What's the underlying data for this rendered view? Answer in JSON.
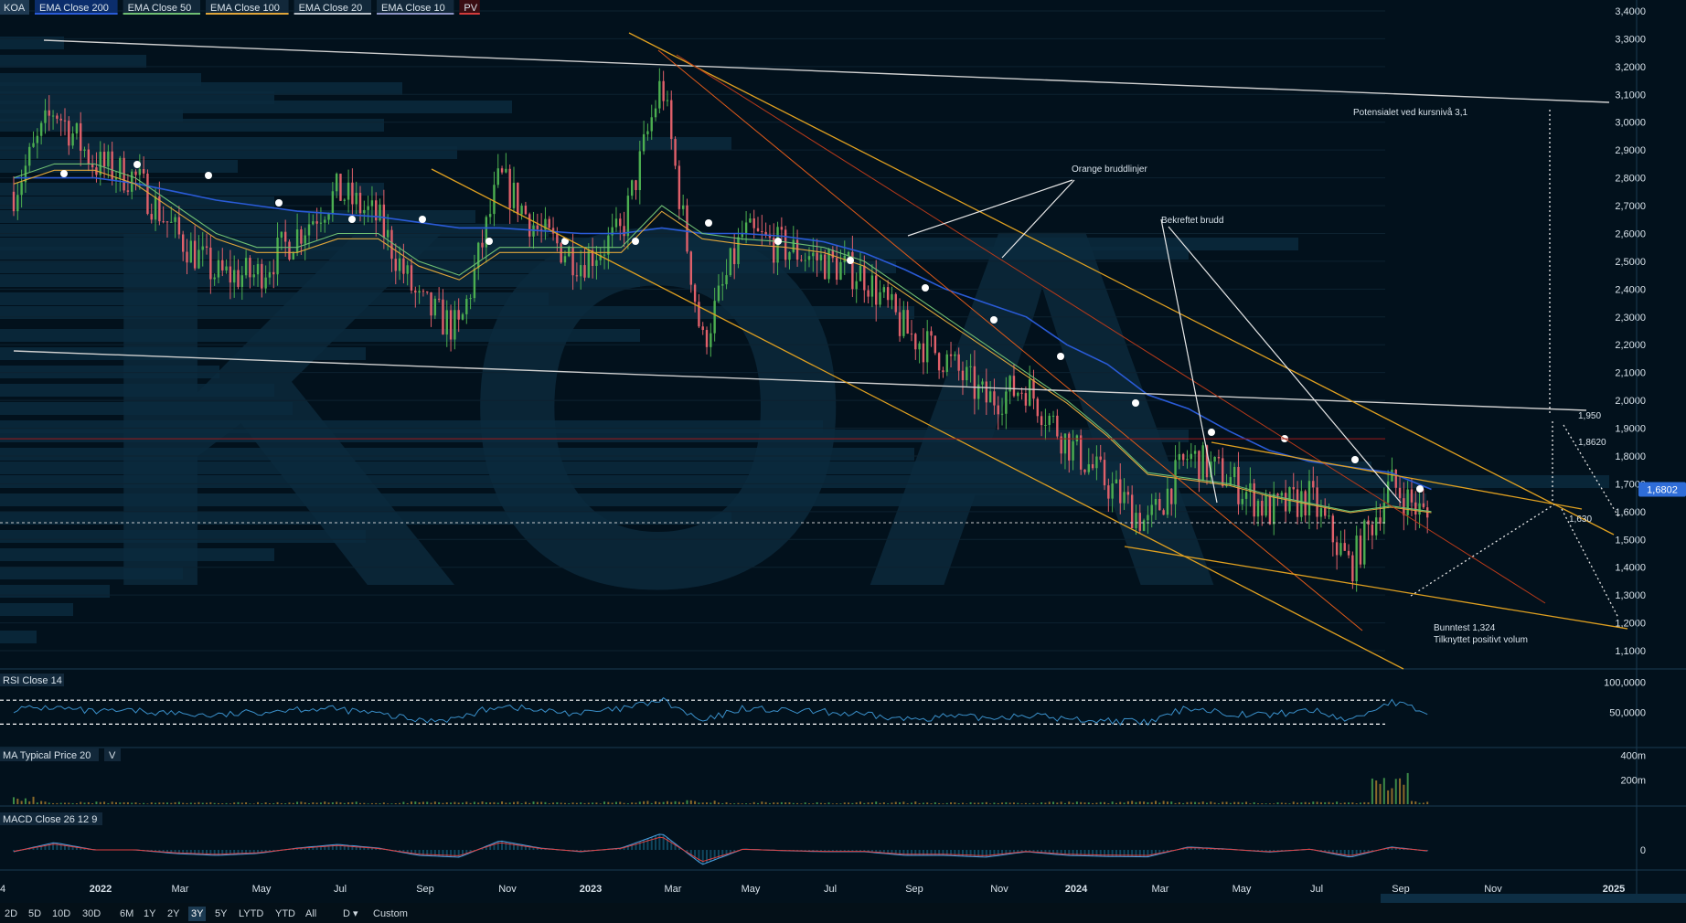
{
  "symbol": "KOA",
  "indicators": [
    {
      "label": "EMA Close 200",
      "color": "#2a5bd7",
      "bg": "#0b2d6b"
    },
    {
      "label": "EMA Close 50",
      "color": "#6fbf73",
      "bg": "#12283a"
    },
    {
      "label": "EMA Close 100",
      "color": "#e0a63a",
      "bg": "#12283a"
    },
    {
      "label": "EMA Close 20",
      "color": "#b8c0c8",
      "bg": "#12283a"
    },
    {
      "label": "EMA Close 10",
      "color": "#8b93c4",
      "bg": "#12283a"
    },
    {
      "label": "PV",
      "color": "#d23b3b",
      "bg": "#3a0d12"
    }
  ],
  "colors": {
    "background": "#02111c",
    "up": "#4caf50",
    "down": "#e0606a",
    "grid": "#0d2230",
    "axis_text": "#d8e2ea"
  },
  "price_axis_labels": [
    "3,4000",
    "3,3000",
    "3,2000",
    "3,1000",
    "3,0000",
    "2,9000",
    "2,8000",
    "2,7000",
    "2,6000",
    "2,5000",
    "2,4000",
    "2,3000",
    "2,2000",
    "2,1000",
    "2,0000",
    "1,9000",
    "1,8000",
    "1,7000",
    "1,6000",
    "1,5000",
    "1,4000",
    "1,3000",
    "1,2000",
    "1,1000"
  ],
  "price_axis_values": [
    3.4,
    3.3,
    3.2,
    3.1,
    3.0,
    2.9,
    2.8,
    2.7,
    2.6,
    2.5,
    2.4,
    2.3,
    2.2,
    2.1,
    2.0,
    1.9,
    1.8,
    1.7,
    1.6,
    1.5,
    1.4,
    1.3,
    1.2,
    1.1
  ],
  "current_price_label": "1,6802",
  "rsi": {
    "title": "RSI Close 14",
    "labels": [
      "100,0000",
      "50,0000"
    ],
    "values": [
      100,
      50
    ]
  },
  "volume": {
    "title": "MA Typical Price 20",
    "extra": "V",
    "labels": [
      "400m",
      "200m"
    ],
    "values": [
      400,
      200
    ]
  },
  "macd": {
    "title": "MACD Close 26 12 9",
    "labels": [
      "0"
    ]
  },
  "time_axis": [
    "2022",
    "Mar",
    "May",
    "Jul",
    "Sep",
    "Nov",
    "2023",
    "Mar",
    "May",
    "Jul",
    "Sep",
    "Nov",
    "2024",
    "Mar",
    "May",
    "Jul",
    "Sep",
    "Nov",
    "2025"
  ],
  "time_axis_first": "4",
  "timeframes": [
    "2D",
    "5D",
    "10D",
    "30D",
    "6M",
    "1Y",
    "2Y",
    "3Y",
    "5Y",
    "LYTD",
    "YTD",
    "All",
    "D ▾",
    "Custom"
  ],
  "active_timeframe": "3Y",
  "annotations": {
    "potential": "Potensialet ved kursnivå 3,1",
    "orange_breaks": "Orange bruddlinjer",
    "confirmed_break": "Bekreftet brudd",
    "bottom_test": "Bunntest 1,324",
    "positive_volume": "Tilknyttet positivt volum",
    "level_1950": "1,950",
    "level_18620": "1,8620",
    "level_1630": "1,630"
  },
  "chart_data": {
    "type": "candlestick",
    "title": "KOA",
    "x_range": [
      "2021-11",
      "2025-01"
    ],
    "ylim": [
      1.1,
      3.4
    ],
    "months": [
      "2021-11",
      "2021-12",
      "2022-01",
      "2022-02",
      "2022-03",
      "2022-04",
      "2022-05",
      "2022-06",
      "2022-07",
      "2022-08",
      "2022-09",
      "2022-10",
      "2022-11",
      "2022-12",
      "2023-01",
      "2023-02",
      "2023-03",
      "2023-04",
      "2023-05",
      "2023-06",
      "2023-07",
      "2023-08",
      "2023-09",
      "2023-10",
      "2023-11",
      "2023-12",
      "2024-01",
      "2024-02",
      "2024-03",
      "2024-04",
      "2024-05",
      "2024-06",
      "2024-07",
      "2024-08",
      "2024-09",
      "2024-10"
    ],
    "close": [
      2.75,
      3.05,
      2.85,
      2.8,
      2.6,
      2.45,
      2.45,
      2.6,
      2.75,
      2.65,
      2.35,
      2.25,
      2.8,
      2.6,
      2.5,
      2.6,
      3.15,
      2.2,
      2.6,
      2.55,
      2.5,
      2.45,
      2.25,
      2.15,
      2.0,
      2.05,
      1.85,
      1.7,
      1.55,
      1.8,
      1.72,
      1.6,
      1.65,
      1.4,
      1.7,
      1.56
    ],
    "ema200": [
      2.8,
      2.8,
      2.8,
      2.78,
      2.75,
      2.72,
      2.7,
      2.68,
      2.67,
      2.66,
      2.64,
      2.62,
      2.62,
      2.61,
      2.6,
      2.6,
      2.62,
      2.6,
      2.6,
      2.59,
      2.57,
      2.53,
      2.47,
      2.4,
      2.35,
      2.3,
      2.2,
      2.13,
      2.02,
      1.97,
      1.89,
      1.82,
      1.78,
      1.76,
      1.74,
      1.68
    ],
    "ema50": [
      2.8,
      2.85,
      2.85,
      2.8,
      2.7,
      2.6,
      2.55,
      2.55,
      2.6,
      2.6,
      2.5,
      2.45,
      2.55,
      2.55,
      2.55,
      2.55,
      2.7,
      2.6,
      2.58,
      2.57,
      2.55,
      2.5,
      2.4,
      2.3,
      2.2,
      2.1,
      2.0,
      1.88,
      1.74,
      1.72,
      1.7,
      1.66,
      1.63,
      1.6,
      1.62,
      1.6
    ],
    "rsi": [
      55,
      58,
      50,
      52,
      48,
      44,
      50,
      56,
      55,
      47,
      36,
      40,
      62,
      52,
      48,
      55,
      70,
      34,
      57,
      52,
      50,
      45,
      38,
      43,
      40,
      46,
      38,
      36,
      32,
      58,
      48,
      45,
      54,
      36,
      68,
      46
    ],
    "volume_m": [
      60,
      25,
      20,
      15,
      20,
      15,
      15,
      20,
      20,
      15,
      20,
      20,
      25,
      20,
      15,
      20,
      25,
      30,
      20,
      15,
      15,
      20,
      20,
      15,
      15,
      15,
      20,
      20,
      25,
      20,
      20,
      15,
      20,
      20,
      240,
      25
    ],
    "levels": [
      {
        "label": "1,950",
        "value": 1.95
      },
      {
        "label": "1,8620",
        "value": 1.862
      },
      {
        "label": "1,630",
        "value": 1.63
      },
      {
        "label": "Bunntest 1,324",
        "value": 1.324
      }
    ]
  }
}
